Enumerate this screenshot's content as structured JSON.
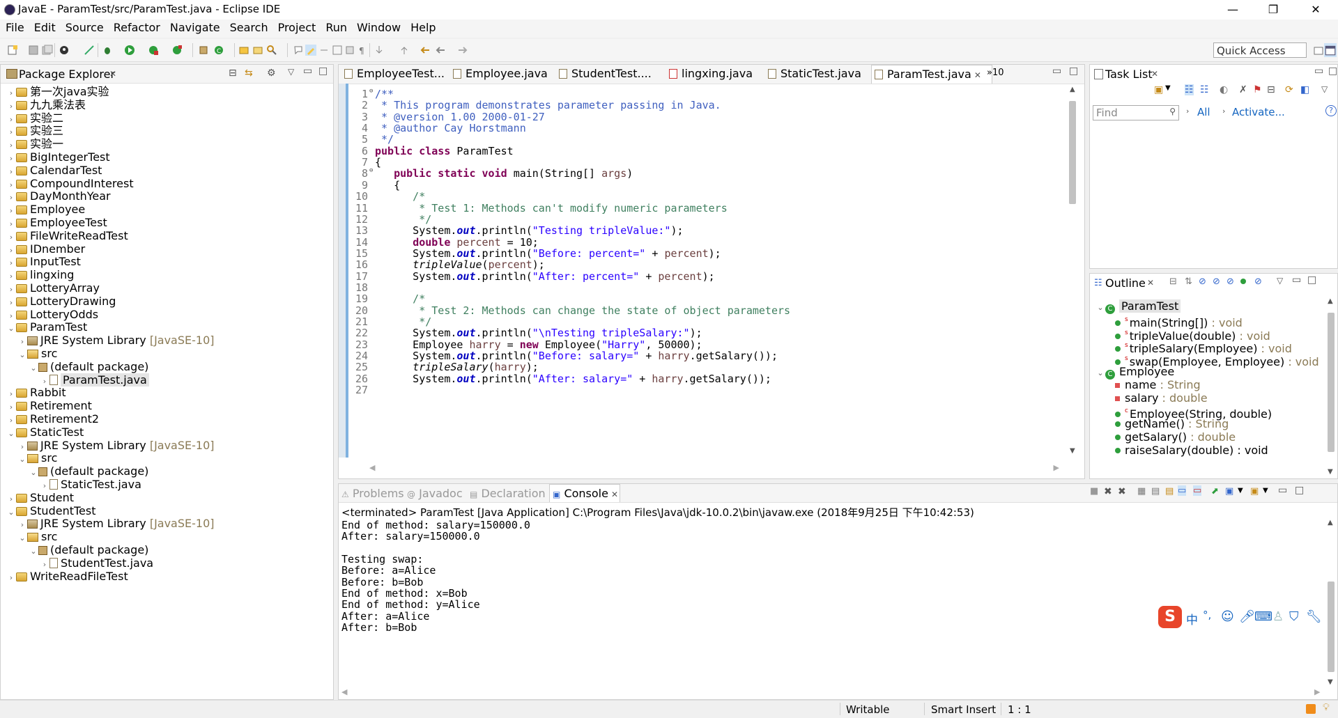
{
  "window": {
    "title": "JavaE - ParamTest/src/ParamTest.java - Eclipse IDE",
    "minimize": "—",
    "maximize": "❐",
    "close": "✕"
  },
  "menu": [
    "File",
    "Edit",
    "Source",
    "Refactor",
    "Navigate",
    "Search",
    "Project",
    "Run",
    "Window",
    "Help"
  ],
  "toolbar": {
    "quick_access": "Quick Access"
  },
  "package_explorer": {
    "title": "Package Explorer",
    "items": [
      {
        "label": "第一次java实验",
        "indent": 0,
        "twisty": "›",
        "icon": "proj"
      },
      {
        "label": "九九乘法表",
        "indent": 0,
        "twisty": "›",
        "icon": "proj"
      },
      {
        "label": "实验二",
        "indent": 0,
        "twisty": "›",
        "icon": "proj"
      },
      {
        "label": "实验三",
        "indent": 0,
        "twisty": "›",
        "icon": "proj"
      },
      {
        "label": "实验一",
        "indent": 0,
        "twisty": "›",
        "icon": "proj"
      },
      {
        "label": "BigIntegerTest",
        "indent": 0,
        "twisty": "›",
        "icon": "proj"
      },
      {
        "label": "CalendarTest",
        "indent": 0,
        "twisty": "›",
        "icon": "proj"
      },
      {
        "label": "CompoundInterest",
        "indent": 0,
        "twisty": "›",
        "icon": "proj"
      },
      {
        "label": "DayMonthYear",
        "indent": 0,
        "twisty": "›",
        "icon": "proj"
      },
      {
        "label": "Employee",
        "indent": 0,
        "twisty": "›",
        "icon": "proj"
      },
      {
        "label": "EmployeeTest",
        "indent": 0,
        "twisty": "›",
        "icon": "proj"
      },
      {
        "label": "FileWriteReadTest",
        "indent": 0,
        "twisty": "›",
        "icon": "proj"
      },
      {
        "label": "IDnember",
        "indent": 0,
        "twisty": "›",
        "icon": "proj"
      },
      {
        "label": "InputTest",
        "indent": 0,
        "twisty": "›",
        "icon": "proj"
      },
      {
        "label": "lingxing",
        "indent": 0,
        "twisty": "›",
        "icon": "proj"
      },
      {
        "label": "LotteryArray",
        "indent": 0,
        "twisty": "›",
        "icon": "proj"
      },
      {
        "label": "LotteryDrawing",
        "indent": 0,
        "twisty": "›",
        "icon": "proj"
      },
      {
        "label": "LotteryOdds",
        "indent": 0,
        "twisty": "›",
        "icon": "proj"
      },
      {
        "label": "ParamTest",
        "indent": 0,
        "twisty": "⌄",
        "icon": "proj"
      },
      {
        "label": "JRE System Library",
        "suffix": " [JavaSE-10]",
        "indent": 1,
        "twisty": "›",
        "icon": "lib"
      },
      {
        "label": "src",
        "indent": 1,
        "twisty": "⌄",
        "icon": "src"
      },
      {
        "label": "(default package)",
        "indent": 2,
        "twisty": "⌄",
        "icon": "pkg"
      },
      {
        "label": "ParamTest.java",
        "indent": 3,
        "twisty": "›",
        "icon": "file",
        "selected": true
      },
      {
        "label": "Rabbit",
        "indent": 0,
        "twisty": "›",
        "icon": "proj"
      },
      {
        "label": "Retirement",
        "indent": 0,
        "twisty": "›",
        "icon": "proj"
      },
      {
        "label": "Retirement2",
        "indent": 0,
        "twisty": "›",
        "icon": "proj"
      },
      {
        "label": "StaticTest",
        "indent": 0,
        "twisty": "⌄",
        "icon": "proj"
      },
      {
        "label": "JRE System Library",
        "suffix": " [JavaSE-10]",
        "indent": 1,
        "twisty": "›",
        "icon": "lib"
      },
      {
        "label": "src",
        "indent": 1,
        "twisty": "⌄",
        "icon": "src"
      },
      {
        "label": "(default package)",
        "indent": 2,
        "twisty": "⌄",
        "icon": "pkg"
      },
      {
        "label": "StaticTest.java",
        "indent": 3,
        "twisty": "›",
        "icon": "file"
      },
      {
        "label": "Student",
        "indent": 0,
        "twisty": "›",
        "icon": "proj"
      },
      {
        "label": "StudentTest",
        "indent": 0,
        "twisty": "⌄",
        "icon": "proj"
      },
      {
        "label": "JRE System Library",
        "suffix": " [JavaSE-10]",
        "indent": 1,
        "twisty": "›",
        "icon": "lib"
      },
      {
        "label": "src",
        "indent": 1,
        "twisty": "⌄",
        "icon": "src"
      },
      {
        "label": "(default package)",
        "indent": 2,
        "twisty": "⌄",
        "icon": "pkg"
      },
      {
        "label": "StudentTest.java",
        "indent": 3,
        "twisty": "›",
        "icon": "file"
      },
      {
        "label": "WriteReadFileTest",
        "indent": 0,
        "twisty": "›",
        "icon": "proj"
      }
    ]
  },
  "editor": {
    "tabs": [
      "EmployeeTest...",
      "Employee.java",
      "StudentTest....",
      "lingxing.java",
      "StaticTest.java",
      "ParamTest.java"
    ],
    "active_tab": "ParamTest.java",
    "overflow": "»10",
    "lines": [
      [
        [
          "cm",
          "/**"
        ]
      ],
      [
        [
          "cm",
          " * This program demonstrates parameter passing in Java."
        ]
      ],
      [
        [
          "cm",
          " * @version 1.00 2000-01-27"
        ]
      ],
      [
        [
          "cm",
          " * @author Cay Horstmann"
        ]
      ],
      [
        [
          "cm",
          " */"
        ]
      ],
      [
        [
          "kw",
          "public class "
        ],
        [
          "",
          "ParamTest"
        ]
      ],
      [
        [
          "",
          "{"
        ]
      ],
      [
        [
          "",
          "   "
        ],
        [
          "kw",
          "public static void "
        ],
        [
          "",
          "main(String[] "
        ],
        [
          "var",
          "args"
        ],
        [
          "",
          ")"
        ]
      ],
      [
        [
          "",
          "   {"
        ]
      ],
      [
        [
          "cm2",
          "      /*"
        ]
      ],
      [
        [
          "cm2",
          "       * Test 1: Methods can't modify numeric parameters"
        ]
      ],
      [
        [
          "cm2",
          "       */"
        ]
      ],
      [
        [
          "",
          "      System."
        ],
        [
          "fld",
          "out"
        ],
        [
          "",
          ".println("
        ],
        [
          "st",
          "\"Testing tripleValue:\""
        ],
        [
          "",
          ");"
        ]
      ],
      [
        [
          "",
          "      "
        ],
        [
          "kw",
          "double "
        ],
        [
          "var",
          "percent"
        ],
        [
          "",
          " = 10;"
        ]
      ],
      [
        [
          "",
          "      System."
        ],
        [
          "fld",
          "out"
        ],
        [
          "",
          ".println("
        ],
        [
          "st",
          "\"Before: percent=\""
        ],
        [
          "",
          " + "
        ],
        [
          "var",
          "percent"
        ],
        [
          "",
          ");"
        ]
      ],
      [
        [
          "",
          "      "
        ],
        [
          "it",
          "tripleValue"
        ],
        [
          "",
          "("
        ],
        [
          "var",
          "percent"
        ],
        [
          "",
          ");"
        ]
      ],
      [
        [
          "",
          "      System."
        ],
        [
          "fld",
          "out"
        ],
        [
          "",
          ".println("
        ],
        [
          "st",
          "\"After: percent=\""
        ],
        [
          "",
          " + "
        ],
        [
          "var",
          "percent"
        ],
        [
          "",
          ");"
        ]
      ],
      [
        [
          "",
          ""
        ]
      ],
      [
        [
          "cm2",
          "      /*"
        ]
      ],
      [
        [
          "cm2",
          "       * Test 2: Methods can change the state of object parameters"
        ]
      ],
      [
        [
          "cm2",
          "       */"
        ]
      ],
      [
        [
          "",
          "      System."
        ],
        [
          "fld",
          "out"
        ],
        [
          "",
          ".println("
        ],
        [
          "st",
          "\"\\nTesting tripleSalary:\""
        ],
        [
          "",
          ");"
        ]
      ],
      [
        [
          "",
          "      Employee "
        ],
        [
          "var",
          "harry"
        ],
        [
          "",
          " = "
        ],
        [
          "kw",
          "new "
        ],
        [
          "",
          "Employee("
        ],
        [
          "st",
          "\"Harry\""
        ],
        [
          "",
          ", 50000);"
        ]
      ],
      [
        [
          "",
          "      System."
        ],
        [
          "fld",
          "out"
        ],
        [
          "",
          ".println("
        ],
        [
          "st",
          "\"Before: salary=\""
        ],
        [
          "",
          " + "
        ],
        [
          "var",
          "harry"
        ],
        [
          "",
          ".getSalary());"
        ]
      ],
      [
        [
          "",
          "      "
        ],
        [
          "it",
          "tripleSalary"
        ],
        [
          "",
          "("
        ],
        [
          "var",
          "harry"
        ],
        [
          "",
          ");"
        ]
      ],
      [
        [
          "",
          "      System."
        ],
        [
          "fld",
          "out"
        ],
        [
          "",
          ".println("
        ],
        [
          "st",
          "\"After: salary=\""
        ],
        [
          "",
          " + "
        ],
        [
          "var",
          "harry"
        ],
        [
          "",
          ".getSalary());"
        ]
      ],
      [
        [
          "",
          ""
        ]
      ]
    ]
  },
  "task_list": {
    "title": "Task List",
    "find_placeholder": "Find",
    "all": "All",
    "activate": "Activate..."
  },
  "outline": {
    "title": "Outline",
    "items": [
      {
        "label": "ParamTest",
        "type": "",
        "kind": "class",
        "indent": 0,
        "twisty": "⌄",
        "selected": true
      },
      {
        "label": "main(String[])",
        "type": " : void",
        "kind": "smethod",
        "indent": 1
      },
      {
        "label": "tripleValue(double)",
        "type": " : void",
        "kind": "smethod",
        "indent": 1
      },
      {
        "label": "tripleSalary(Employee)",
        "type": " : void",
        "kind": "smethod",
        "indent": 1
      },
      {
        "label": "swap(Employee, Employee)",
        "type": " : void",
        "kind": "smethod",
        "indent": 1
      },
      {
        "label": "Employee",
        "type": "",
        "kind": "class",
        "indent": 0,
        "twisty": "⌄"
      },
      {
        "label": "name",
        "type": " : String",
        "kind": "field",
        "indent": 1
      },
      {
        "label": "salary",
        "type": " : double",
        "kind": "field",
        "indent": 1
      },
      {
        "label": "Employee(String, double)",
        "type": "",
        "kind": "ctor",
        "indent": 1
      },
      {
        "label": "getName()",
        "type": " : String",
        "kind": "method",
        "indent": 1
      },
      {
        "label": "getSalary()",
        "type": " : double",
        "kind": "method",
        "indent": 1
      },
      {
        "label": "raiseSalary(double) : void",
        "type": "",
        "kind": "method",
        "indent": 1
      }
    ]
  },
  "bottom_tabs": [
    "Problems",
    "Javadoc",
    "Declaration",
    "Console"
  ],
  "console": {
    "header": "<terminated> ParamTest [Java Application] C:\\Program Files\\Java\\jdk-10.0.2\\bin\\javaw.exe (2018年9月25日 下午10:42:53)",
    "lines": [
      "End of method: salary=150000.0",
      "After: salary=150000.0",
      "",
      "Testing swap:",
      "Before: a=Alice",
      "Before: b=Bob",
      "End of method: x=Bob",
      "End of method: y=Alice",
      "After: a=Alice",
      "After: b=Bob"
    ]
  },
  "status": {
    "writable": "Writable",
    "insert": "Smart Insert",
    "position": "1 : 1"
  },
  "ime": {
    "logo": "S",
    "lang": "中",
    "punct": "°,",
    "icons": [
      "emoji-icon",
      "mic-icon",
      "keyboard-icon",
      "user-icon",
      "shirt-icon",
      "wrench-icon"
    ]
  }
}
